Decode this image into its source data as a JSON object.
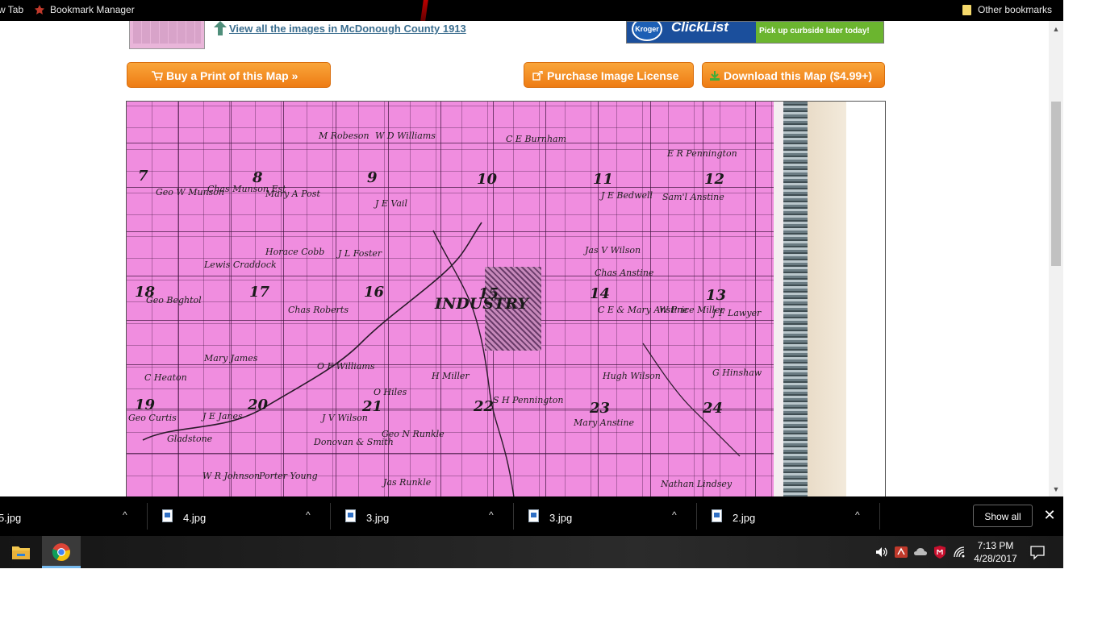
{
  "bookmarks_bar": {
    "left_item": "w Tab",
    "bookmark_manager": "Bookmark Manager",
    "other_bookmarks": "Other bookmarks"
  },
  "page": {
    "view_all_link": "View all the images in McDonough County 1913",
    "ad": {
      "logo": "Kroger",
      "brand": "ClickList",
      "cta": "Pick up curbside later today!"
    },
    "buttons": {
      "buy_print": "Buy a Print of this Map »",
      "purchase_license": "Purchase Image License",
      "download": "Download this Map ($4.99+)"
    },
    "map": {
      "town": "INDUSTRY",
      "sections": [
        "7",
        "8",
        "9",
        "10",
        "11",
        "12",
        "18",
        "17",
        "16",
        "15",
        "14",
        "13",
        "19",
        "20",
        "21",
        "22",
        "23",
        "24"
      ],
      "owners": [
        "Geo W Munson",
        "Chas Munson Est",
        "Mary A Post",
        "J E Vail",
        "M Robeson",
        "W D Williams",
        "C E Burnham",
        "J E Bedwell",
        "E R Pennington",
        "Sam'l Anstine",
        "Jas V Wilson",
        "Chas Anstine",
        "Lewis Craddock",
        "Horace Cobb",
        "J L Foster",
        "Geo Beghtol",
        "Chas Roberts",
        "C E & Mary Anstine",
        "W Price Miller",
        "J F Lawyer",
        "Mary James",
        "O F Williams",
        "H Miller",
        "C Heaton",
        "Geo N Runkle",
        "O Hiles",
        "S H Pennington",
        "Hugh Wilson",
        "G Hinshaw",
        "Geo Curtis",
        "J E Janes",
        "J V Wilson",
        "Donovan & Smith",
        "Porter Young",
        "Jas Runkle",
        "Nathan Lindsey",
        "W R Johnson",
        "Mary Anstine",
        "Gladstone"
      ]
    }
  },
  "downloads": {
    "items": [
      "5.jpg",
      "4.jpg",
      "3.jpg",
      "3.jpg",
      "2.jpg"
    ],
    "show_all": "Show all",
    "close": "✕"
  },
  "taskbar": {
    "time": "7:13 PM",
    "date": "4/28/2017"
  },
  "colors": {
    "button_orange": "#f08a1e",
    "map_pink": "#f08ddf",
    "link_blue": "#3b6e8f",
    "chrome_active": "#76b9ed"
  }
}
